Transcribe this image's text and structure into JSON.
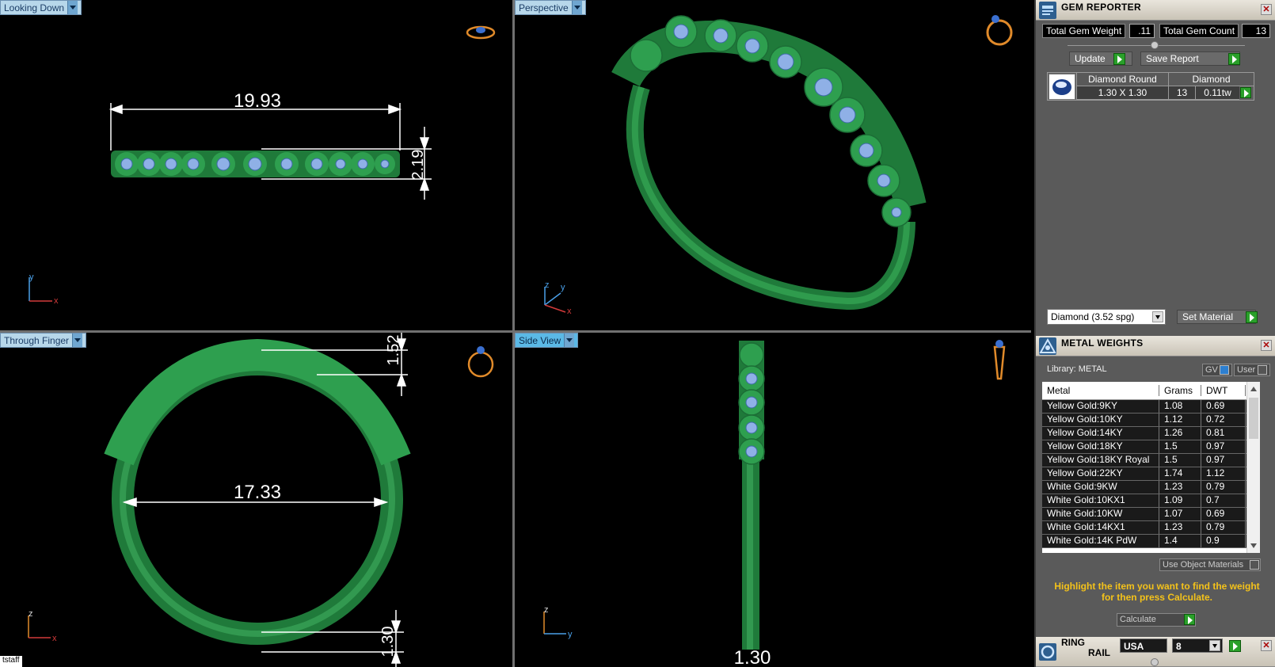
{
  "viewports": {
    "top_left": {
      "label": "Looking Down",
      "dim1": "19.93",
      "dim2": "2.19",
      "axis_a": "y",
      "axis_b": "x"
    },
    "top_right": {
      "label": "Perspective",
      "axis_a": "z",
      "axis_b": "y",
      "axis_c": "x"
    },
    "bot_left": {
      "label": "Through Finger",
      "dim1": "17.33",
      "dim2": "1.52",
      "dim3": "1.30",
      "axis_a": "z",
      "axis_b": "x"
    },
    "bot_right": {
      "label": "Side View",
      "dim1": "1.30",
      "axis_a": "z",
      "axis_b": "y"
    }
  },
  "statusbar": {
    "text": "tstaff"
  },
  "gem_reporter": {
    "title": "GEM REPORTER",
    "total_weight_label": "Total Gem Weight",
    "total_weight_value": ".11",
    "total_count_label": "Total Gem Count",
    "total_count_value": "13",
    "update_label": "Update",
    "save_report_label": "Save Report",
    "table": {
      "col1_header": "Diamond Round",
      "col2_header": "Diamond",
      "size": "1.30 X 1.30",
      "count": "13",
      "weight": "0.11tw"
    },
    "material_select": "Diamond    (3.52 spg)",
    "set_material_label": "Set Material"
  },
  "metal_weights": {
    "title": "METAL WEIGHTS",
    "library_label": "Library: METAL",
    "gv_label": "GV",
    "user_label": "User",
    "headers": [
      "Metal",
      "Grams",
      "DWT"
    ],
    "rows": [
      [
        "Yellow Gold:9KY",
        "1.08",
        "0.69"
      ],
      [
        "Yellow Gold:10KY",
        "1.12",
        "0.72"
      ],
      [
        "Yellow Gold:14KY",
        "1.26",
        "0.81"
      ],
      [
        "Yellow Gold:18KY",
        "1.5",
        "0.97"
      ],
      [
        "Yellow Gold:18KY Royal",
        "1.5",
        "0.97"
      ],
      [
        "Yellow Gold:22KY",
        "1.74",
        "1.12"
      ],
      [
        "White Gold:9KW",
        "1.23",
        "0.79"
      ],
      [
        "White Gold:10KX1",
        "1.09",
        "0.7"
      ],
      [
        "White Gold:10KW",
        "1.07",
        "0.69"
      ],
      [
        "White Gold:14KX1",
        "1.23",
        "0.79"
      ],
      [
        "White Gold:14K PdW",
        "1.4",
        "0.9"
      ]
    ],
    "use_object_materials_label": "Use Object Materials",
    "hint": "Highlight the item you want to find the weight for then press Calculate.",
    "calculate_label": "Calculate"
  },
  "ring_rail": {
    "title_line1": "RING",
    "title_line2": "RAIL",
    "standard": "USA",
    "size": "8"
  },
  "colors": {
    "metal_green": "#2f9a4a",
    "gem_blue": "#8fb0e6",
    "panel_bg": "#5a5a5a",
    "accent_orange": "#e08a2a"
  }
}
